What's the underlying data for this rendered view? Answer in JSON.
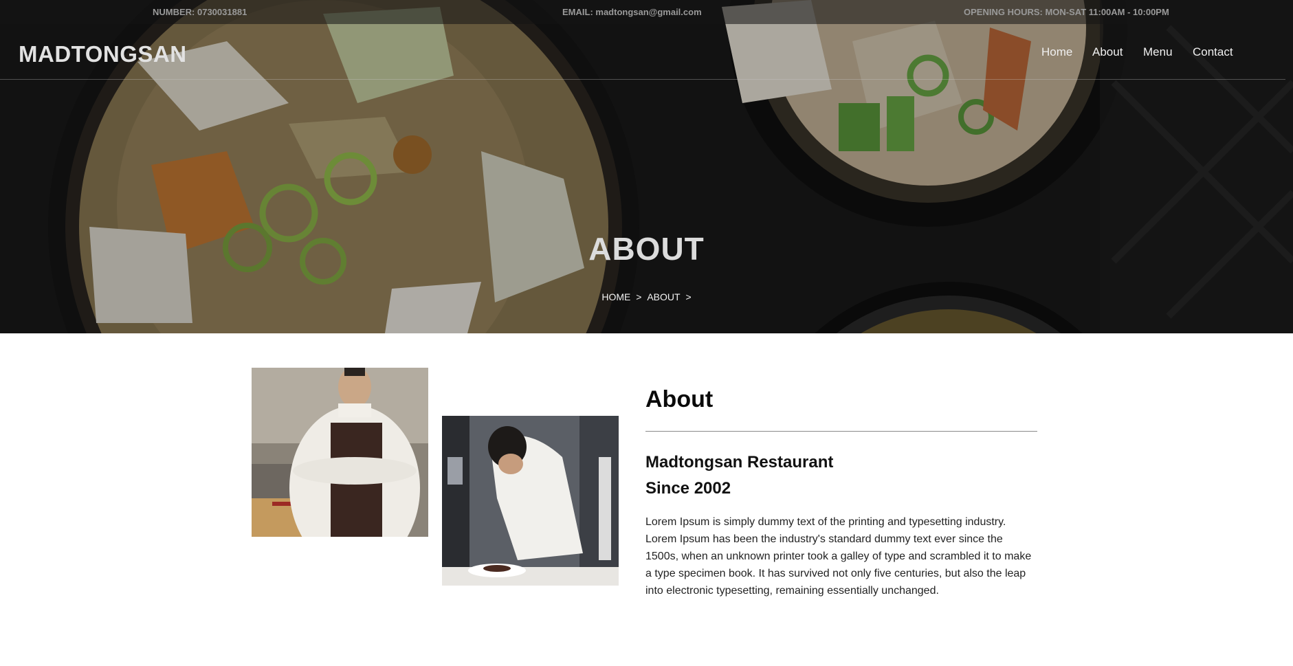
{
  "topbar": {
    "number": "NUMBER: 0730031881",
    "email": "EMAIL: madtongsan@gmail.com",
    "hours": "OPENING HOURS: MON-SAT 11:00AM - 10:00PM"
  },
  "brand": {
    "logo": "MADTONGSAN"
  },
  "nav": {
    "items": [
      {
        "label": "Home"
      },
      {
        "label": "About"
      },
      {
        "label": "Menu"
      },
      {
        "label": "Contact"
      }
    ]
  },
  "hero": {
    "title": "ABOUT",
    "breadcrumb": [
      "HOME",
      ">",
      "ABOUT",
      ">"
    ]
  },
  "about": {
    "heading": "About",
    "subtitle_line1": "Madtongsan Restaurant",
    "subtitle_line2": "Since 2002",
    "body": "Lorem Ipsum is simply dummy text of the printing and typesetting industry. Lorem Ipsum has been the industry's standard dummy text ever since the 1500s, when an unknown printer took a galley of type and scrambled it to make a type specimen book. It has survived not only five centuries, but also the leap into electronic typesetting, remaining essentially unchanged."
  }
}
